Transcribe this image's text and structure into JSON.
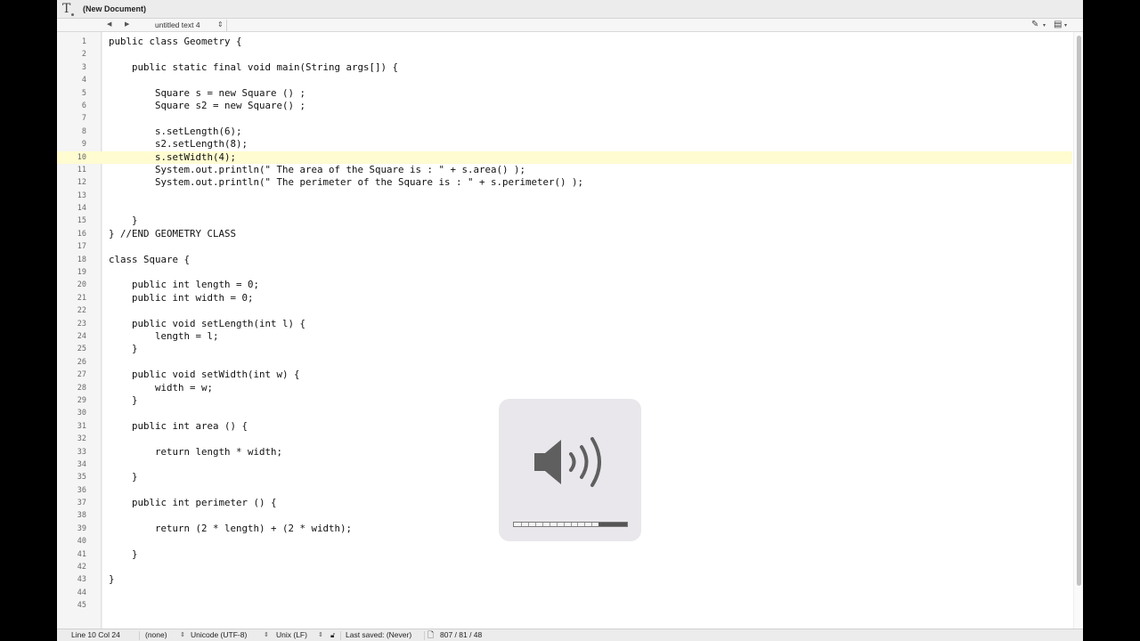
{
  "window": {
    "title": "(New Document)"
  },
  "navbar": {
    "document_name": "untitled text 4"
  },
  "editor": {
    "current_line": 10,
    "lines": [
      "public class Geometry {",
      "",
      "    public static final void main(String args[]) {",
      "",
      "        Square s = new Square () ;",
      "        Square s2 = new Square() ;",
      "",
      "        s.setLength(6);",
      "        s2.setLength(8);",
      "        s.setWidth(4);",
      "        System.out.println(\" The area of the Square is : \" + s.area() );",
      "        System.out.println(\" The perimeter of the Square is : \" + s.perimeter() );",
      "",
      "",
      "    }",
      "} //END GEOMETRY CLASS",
      "",
      "class Square {",
      "",
      "    public int length = 0;",
      "    public int width = 0;",
      "",
      "    public void setLength(int l) {",
      "        length = l;",
      "    }",
      "",
      "    public void setWidth(int w) {",
      "        width = w;",
      "    }",
      "",
      "    public int area () {",
      "",
      "        return length * width;",
      "",
      "    }",
      "",
      "    public int perimeter () {",
      "",
      "        return (2 * length) + (2 * width);",
      "",
      "    }",
      "",
      "}",
      "",
      ""
    ]
  },
  "statusbar": {
    "position": "Line 10 Col 24",
    "language": "(none)",
    "encoding": "Unicode (UTF-8)",
    "line_endings": "Unix (LF)",
    "last_saved": "Last saved: (Never)",
    "stats": "807 / 81 / 48"
  },
  "volume_hud": {
    "level": 0.25,
    "segments": 16
  },
  "icons": {
    "app": "text-editor-icon",
    "nav_back": "back-arrow-icon",
    "nav_forward": "forward-arrow-icon",
    "pencil": "pencil-icon",
    "document": "document-icon",
    "lock": "lock-icon",
    "file": "file-icon",
    "speaker": "speaker-volume-icon"
  },
  "colors": {
    "current_line_highlight": "#fefcd0",
    "gutter_background": "#f5f5f5"
  }
}
